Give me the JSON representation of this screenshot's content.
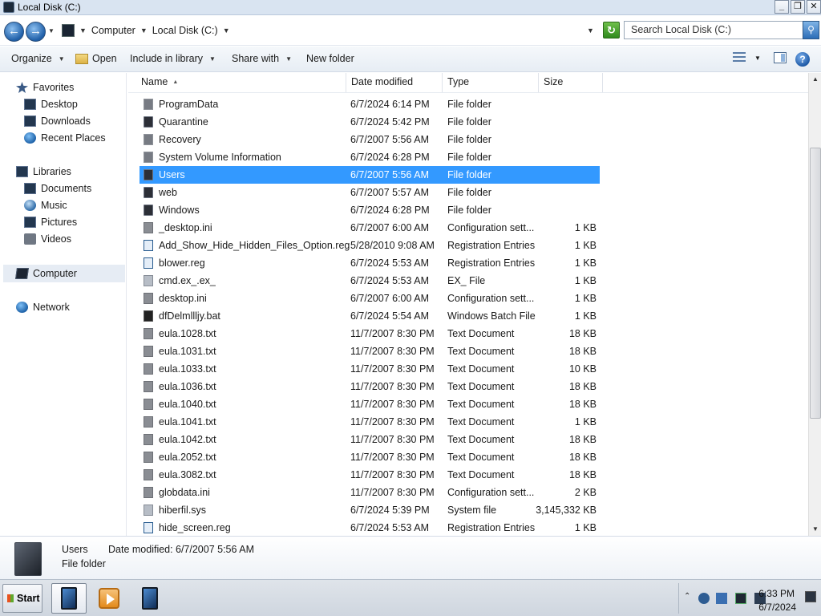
{
  "window": {
    "title": "Local Disk (C:)",
    "minimize": "_",
    "maximize": "❐",
    "close": "✕"
  },
  "address": {
    "crumbs": [
      "Computer",
      "Local Disk (C:)"
    ],
    "search_placeholder": "Search Local Disk (C:)"
  },
  "toolbar": {
    "organize": "Organize",
    "open": "Open",
    "include_in_library": "Include in library",
    "share_with": "Share with",
    "new_folder": "New folder"
  },
  "navpane": {
    "favorites": "Favorites",
    "desktop": "Desktop",
    "downloads": "Downloads",
    "recent_places": "Recent Places",
    "libraries": "Libraries",
    "documents": "Documents",
    "music": "Music",
    "pictures": "Pictures",
    "videos": "Videos",
    "computer": "Computer",
    "network": "Network"
  },
  "columns": {
    "name": "Name",
    "date_modified": "Date modified",
    "type": "Type",
    "size": "Size"
  },
  "files": [
    {
      "name": "ProgramData",
      "date": "6/7/2024 6:14 PM",
      "type": "File folder",
      "size": "",
      "icon": "folder-hidden-icon"
    },
    {
      "name": "Quarantine",
      "date": "6/7/2024 5:42 PM",
      "type": "File folder",
      "size": "",
      "icon": "folder-icon"
    },
    {
      "name": "Recovery",
      "date": "6/7/2007 5:56 AM",
      "type": "File folder",
      "size": "",
      "icon": "folder-lock-icon"
    },
    {
      "name": "System Volume Information",
      "date": "6/7/2024 6:28 PM",
      "type": "File folder",
      "size": "",
      "icon": "folder-lock-icon"
    },
    {
      "name": "Users",
      "date": "6/7/2007 5:56 AM",
      "type": "File folder",
      "size": "",
      "icon": "folder-icon"
    },
    {
      "name": "web",
      "date": "6/7/2007 5:57 AM",
      "type": "File folder",
      "size": "",
      "icon": "folder-icon"
    },
    {
      "name": "Windows",
      "date": "6/7/2024 6:28 PM",
      "type": "File folder",
      "size": "",
      "icon": "folder-icon"
    },
    {
      "name": "_desktop.ini",
      "date": "6/7/2007 6:00 AM",
      "type": "Configuration sett...",
      "size": "1 KB",
      "icon": "config-file-icon"
    },
    {
      "name": "Add_Show_Hide_Hidden_Files_Option.reg",
      "date": "5/28/2010 9:08 AM",
      "type": "Registration Entries",
      "size": "1 KB",
      "icon": "registry-file-icon"
    },
    {
      "name": "blower.reg",
      "date": "6/7/2024 5:53 AM",
      "type": "Registration Entries",
      "size": "1 KB",
      "icon": "registry-file-icon"
    },
    {
      "name": "cmd.ex_.ex_",
      "date": "6/7/2024 5:53 AM",
      "type": "EX_ File",
      "size": "1 KB",
      "icon": "generic-file-icon"
    },
    {
      "name": "desktop.ini",
      "date": "6/7/2007 6:00 AM",
      "type": "Configuration sett...",
      "size": "1 KB",
      "icon": "config-file-icon"
    },
    {
      "name": "dfDelmllljy.bat",
      "date": "6/7/2024 5:54 AM",
      "type": "Windows Batch File",
      "size": "1 KB",
      "icon": "batch-file-icon"
    },
    {
      "name": "eula.1028.txt",
      "date": "11/7/2007 8:30 PM",
      "type": "Text Document",
      "size": "18 KB",
      "icon": "text-file-icon"
    },
    {
      "name": "eula.1031.txt",
      "date": "11/7/2007 8:30 PM",
      "type": "Text Document",
      "size": "18 KB",
      "icon": "text-file-icon"
    },
    {
      "name": "eula.1033.txt",
      "date": "11/7/2007 8:30 PM",
      "type": "Text Document",
      "size": "10 KB",
      "icon": "text-file-icon"
    },
    {
      "name": "eula.1036.txt",
      "date": "11/7/2007 8:30 PM",
      "type": "Text Document",
      "size": "18 KB",
      "icon": "text-file-icon"
    },
    {
      "name": "eula.1040.txt",
      "date": "11/7/2007 8:30 PM",
      "type": "Text Document",
      "size": "18 KB",
      "icon": "text-file-icon"
    },
    {
      "name": "eula.1041.txt",
      "date": "11/7/2007 8:30 PM",
      "type": "Text Document",
      "size": "1 KB",
      "icon": "text-file-icon"
    },
    {
      "name": "eula.1042.txt",
      "date": "11/7/2007 8:30 PM",
      "type": "Text Document",
      "size": "18 KB",
      "icon": "text-file-icon"
    },
    {
      "name": "eula.2052.txt",
      "date": "11/7/2007 8:30 PM",
      "type": "Text Document",
      "size": "18 KB",
      "icon": "text-file-icon"
    },
    {
      "name": "eula.3082.txt",
      "date": "11/7/2007 8:30 PM",
      "type": "Text Document",
      "size": "18 KB",
      "icon": "text-file-icon"
    },
    {
      "name": "globdata.ini",
      "date": "11/7/2007 8:30 PM",
      "type": "Configuration sett...",
      "size": "2 KB",
      "icon": "config-file-icon"
    },
    {
      "name": "hiberfil.sys",
      "date": "6/7/2024 5:39 PM",
      "type": "System file",
      "size": "3,145,332 KB",
      "icon": "system-file-icon"
    },
    {
      "name": "hide_screen.reg",
      "date": "6/7/2024 5:53 AM",
      "type": "Registration Entries",
      "size": "1 KB",
      "icon": "registry-file-icon"
    }
  ],
  "selected_index": 4,
  "details": {
    "name": "Users",
    "date_label": "Date modified:",
    "date_value": "6/7/2007 5:56 AM",
    "type": "File folder"
  },
  "taskbar": {
    "start": "Start",
    "clock_time": "6:33 PM",
    "clock_date": "6/7/2024"
  },
  "colors": {
    "selection": "#3399ff",
    "toolbar_bg": "#e7edf4",
    "titlebar_bg": "#d9e4f1"
  }
}
